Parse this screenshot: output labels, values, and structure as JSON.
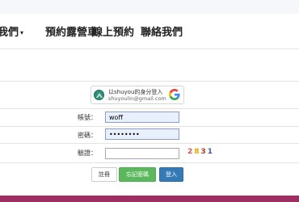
{
  "navbar": {
    "items": [
      {
        "label": "我們",
        "has_dropdown": true
      },
      {
        "label": "預約露營車",
        "has_dropdown": false
      },
      {
        "label": "線上預約",
        "has_dropdown": false
      },
      {
        "label": "聯絡我們",
        "has_dropdown": false
      }
    ],
    "dropdown_caret": "▾"
  },
  "google_signin": {
    "line1": "以shuyou的身分登入",
    "line2": "shuyoulin@gmail.com",
    "icon": "google-g-icon"
  },
  "form": {
    "username_label": "帳號：",
    "username_value": "woff",
    "password_label": "密碼：",
    "password_value": "••••••••",
    "captcha_label": "驗證：",
    "captcha_value": "",
    "captcha_digits": [
      {
        "text": "2",
        "color": "#d9534f"
      },
      {
        "text": "8",
        "color": "#e0a800"
      },
      {
        "text": "3",
        "color": "#c0392b"
      },
      {
        "text": "1",
        "color": "#3a5fa8"
      }
    ]
  },
  "buttons": {
    "register": "註冊",
    "forgot": "忘記密碼",
    "login": "登入"
  },
  "colors": {
    "footer": "#9b2f62",
    "login": "#337ab7",
    "forgot": "#5cb85c"
  }
}
